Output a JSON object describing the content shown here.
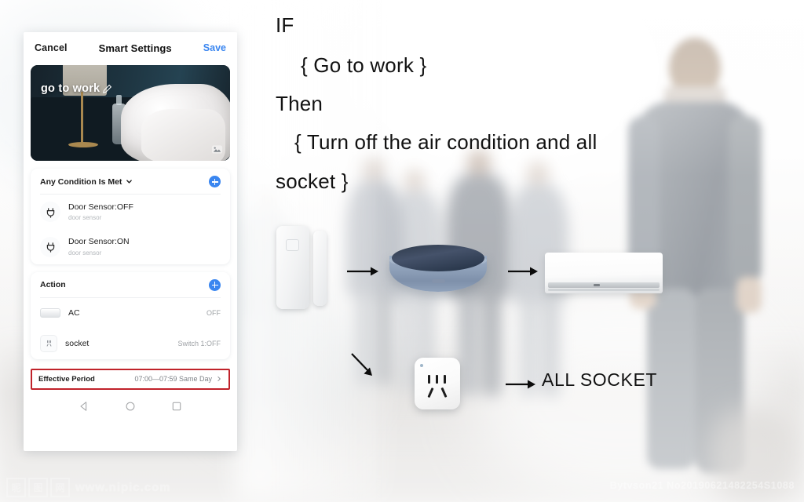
{
  "background": {
    "scene_description": "blurred businessman walking away in office corridor",
    "accent_blue": "#3a86f0",
    "alert_red": "#c0222a"
  },
  "phone": {
    "nav": {
      "cancel_label": "Cancel",
      "title": "Smart Settings",
      "save_label": "Save"
    },
    "hero": {
      "scene_title": "go to work",
      "edit_icon": "pencil-icon",
      "image_icon": "image-icon"
    },
    "condition_section": {
      "header_label": "Any Condition Is Met",
      "chevron_icon": "chevron-down-icon",
      "add_icon": "plus-icon",
      "items": [
        {
          "icon": "plug-icon",
          "title": "Door Sensor:OFF",
          "subtitle": "door sensor"
        },
        {
          "icon": "plug-icon",
          "title": "Door Sensor:ON",
          "subtitle": "door sensor"
        }
      ]
    },
    "action_section": {
      "header_label": "Action",
      "add_icon": "plus-icon",
      "items": [
        {
          "icon": "air-conditioner-icon",
          "title": "AC",
          "value": "OFF"
        },
        {
          "icon": "socket-icon",
          "title": "socket",
          "value": "Switch 1:OFF"
        }
      ]
    },
    "effective_period": {
      "label": "Effective Period",
      "value": "07:00—07:59 Same Day",
      "chevron_icon": "chevron-right-icon"
    },
    "android_nav": {
      "back_icon": "back-triangle-icon",
      "home_icon": "home-circle-icon",
      "recents_icon": "recents-square-icon"
    }
  },
  "annotations": {
    "if_label": "IF",
    "condition_text": "{ Go to work }",
    "then_label": "Then",
    "action_text_line1": "{ Turn off the air condition and all",
    "action_text_line2": "socket }",
    "all_socket_label": "ALL SOCKET"
  },
  "devices": {
    "door_sensor": "door-sensor-device",
    "ir_hub": "infrared-hub-device",
    "air_conditioner": "air-conditioner-device",
    "smart_plug": "smart-plug-device",
    "arrow_hub": "arrow-right-icon",
    "arrow_ac": "arrow-right-icon",
    "arrow_plug": "arrow-down-right-icon",
    "arrow_socket_label": "arrow-right-icon"
  },
  "watermark": {
    "cn_char_1": "昵",
    "cn_char_2": "图",
    "cn_char_3": "网",
    "url": "www.nipic.com",
    "credit": "Bytvson21 No20190621482254S1088"
  }
}
